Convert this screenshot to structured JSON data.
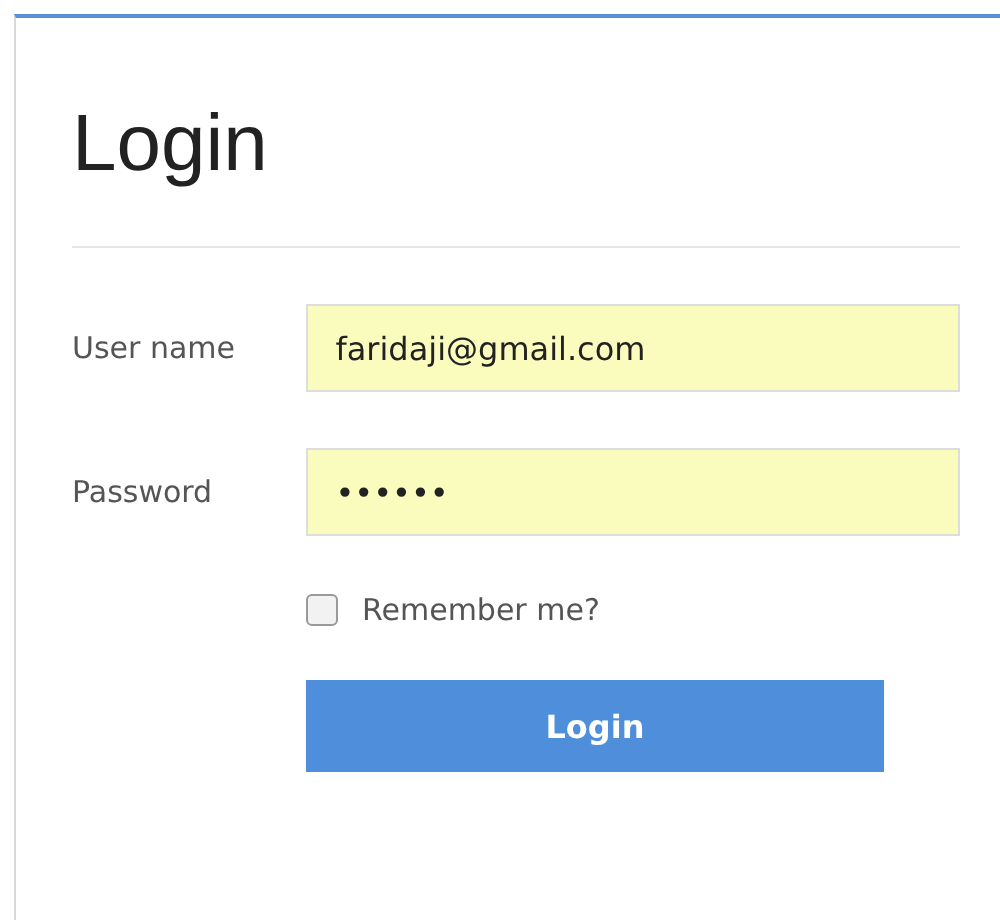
{
  "title": "Login",
  "fields": [
    {
      "label": "User name",
      "value": "faridaji@gmail.com"
    },
    {
      "label": "Password",
      "value": "••••••"
    }
  ],
  "remember": {
    "label": "Remember me?",
    "checked": false
  },
  "button": "Login"
}
